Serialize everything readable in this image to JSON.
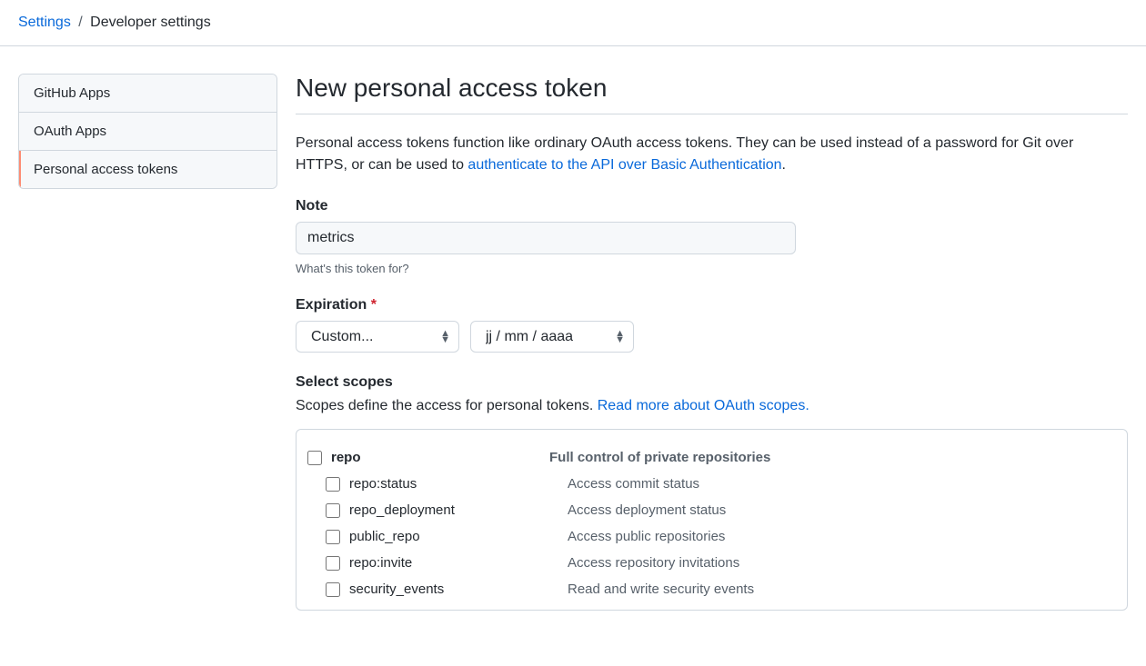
{
  "breadcrumb": {
    "parent": "Settings",
    "current": "Developer settings"
  },
  "sidebar": {
    "items": [
      {
        "label": "GitHub Apps"
      },
      {
        "label": "OAuth Apps"
      },
      {
        "label": "Personal access tokens"
      }
    ]
  },
  "page": {
    "title": "New personal access token",
    "intro_before": "Personal access tokens function like ordinary OAuth access tokens. They can be used instead of a password for Git over HTTPS, or can be used to ",
    "intro_link": "authenticate to the API over Basic Authentication",
    "intro_after": "."
  },
  "note": {
    "label": "Note",
    "value": "metrics",
    "help": "What's this token for?"
  },
  "expiration": {
    "label": "Expiration",
    "select_value": "Custom...",
    "date_value": "jj / mm / aaaa"
  },
  "scopes": {
    "header": "Select scopes",
    "desc_before": "Scopes define the access for personal tokens. ",
    "desc_link": "Read more about OAuth scopes.",
    "items": [
      {
        "name": "repo",
        "desc": "Full control of private repositories",
        "parent": true
      },
      {
        "name": "repo:status",
        "desc": "Access commit status",
        "parent": false
      },
      {
        "name": "repo_deployment",
        "desc": "Access deployment status",
        "parent": false
      },
      {
        "name": "public_repo",
        "desc": "Access public repositories",
        "parent": false
      },
      {
        "name": "repo:invite",
        "desc": "Access repository invitations",
        "parent": false
      },
      {
        "name": "security_events",
        "desc": "Read and write security events",
        "parent": false
      }
    ]
  }
}
